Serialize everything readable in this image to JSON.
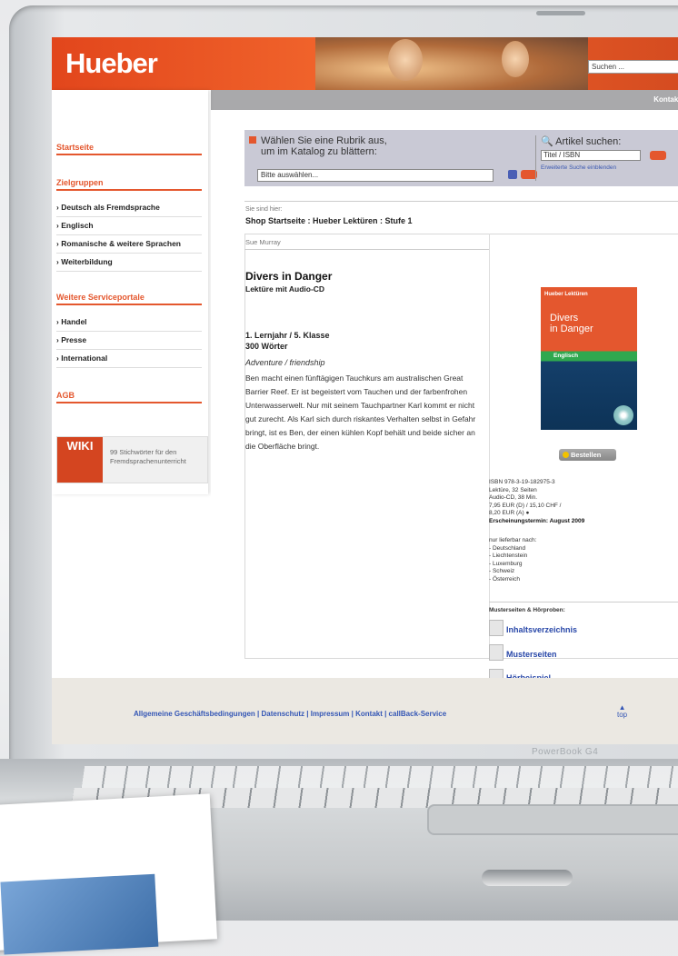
{
  "header": {
    "logo": "Hueber",
    "search_placeholder": "Suchen ...",
    "kontakt": "Kontakt"
  },
  "sidebar": {
    "startseite": "Startseite",
    "zielgruppen": "Zielgruppen",
    "items": [
      "Deutsch als Fremdsprache",
      "Englisch",
      "Romanische & weitere Sprachen",
      "Weiterbildung"
    ],
    "serviceportale": "Weitere Serviceportale",
    "service_items": [
      "Handel",
      "Presse",
      "International"
    ],
    "agb": "AGB",
    "wiki_logo": "WIKI",
    "wiki_text": "99 Stichwörter für den Fremdsprachenunterricht"
  },
  "catalog": {
    "rubrik_title_1": "Wählen Sie eine Rubrik aus,",
    "rubrik_title_2": "um im Katalog zu blättern:",
    "select_value": "Bitte auswählen...",
    "search_title": "Artikel suchen:",
    "search_value": "Titel / ISBN",
    "extended_search": "Erweiterte Suche einblenden"
  },
  "breadcrumb": {
    "label": "Sie sind hier:",
    "path": "Shop Startseite : Hueber Lektüren : Stufe 1"
  },
  "product": {
    "author": "Sue Murray",
    "title": "Divers in Danger",
    "subtitle": "Lektüre mit Audio-CD",
    "level_1": "1. Lernjahr / 5. Klasse",
    "level_2": "300 Wörter",
    "genre": "Adventure / friendship",
    "description": "Ben macht einen fünftägigen Tauchkurs am australischen Great Barrier Reef. Er ist begeistert vom Tauchen und der farbenfrohen Unterwasserwelt. Nur mit seinem Tauchpartner Karl kommt er nicht gut zurecht. Als Karl sich durch riskantes Verhalten selbst in Gefahr bringt, ist es Ben, der einen kühlen Kopf behält und beide sicher an die Oberfläche bringt.",
    "cover_series": "Hueber Lektüren",
    "cover_title_1": "Divers",
    "cover_title_2": "in Danger",
    "cover_lang": "Englisch",
    "order": "Bestellen",
    "meta": [
      "ISBN 978-3-19-182975-3",
      "Lektüre, 32 Seiten",
      "Audio-CD, 38 Min.",
      "7,95 EUR (D) / 15,10 CHF /",
      "8,20 EUR (A) ●"
    ],
    "release": "Erscheinungstermin: August 2009",
    "avail_label": "nur lieferbar nach:",
    "avail": [
      "- Deutschland",
      "- Liechtenstein",
      "- Luxemburg",
      "- Schweiz",
      "- Österreich"
    ],
    "samples_label": "Musterseiten & Hörproben:",
    "samples": [
      "Inhaltsverzeichnis",
      "Musterseiten",
      "Hörbeispiel"
    ]
  },
  "footer": {
    "links": "Allgemeine Geschäftsbedingungen | Datenschutz | Impressum | Kontakt | callBack-Service",
    "top": "top"
  },
  "device": {
    "model": "PowerBook G4"
  }
}
